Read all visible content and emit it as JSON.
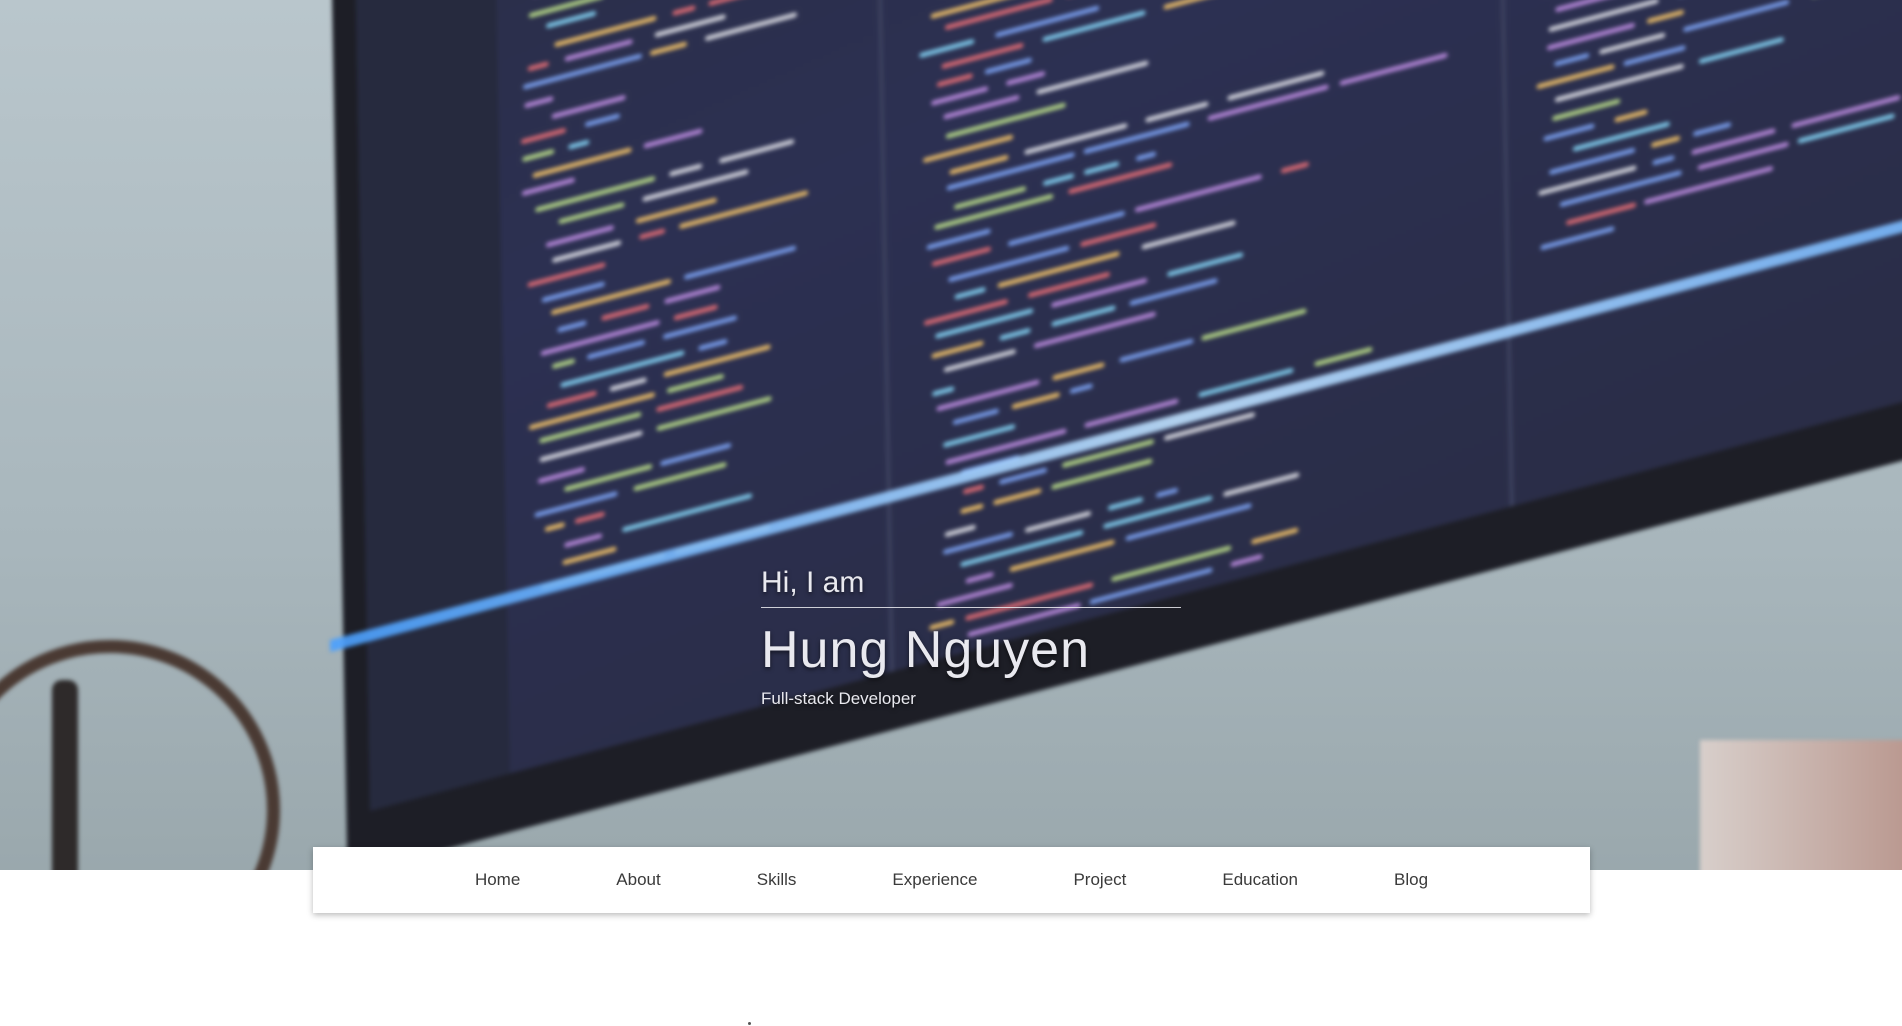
{
  "hero": {
    "greeting": "Hi, I am",
    "name": "Hung Nguyen",
    "role": "Full-stack Developer"
  },
  "nav": {
    "items": [
      {
        "label": "Home"
      },
      {
        "label": "About"
      },
      {
        "label": "Skills"
      },
      {
        "label": "Experience"
      },
      {
        "label": "Project"
      },
      {
        "label": "Education"
      },
      {
        "label": "Blog"
      }
    ]
  },
  "colors": {
    "hero_text": "#e9e9ef",
    "nav_bg": "#ffffff",
    "nav_text": "#3a3a3a",
    "screen": "#2c3052"
  }
}
